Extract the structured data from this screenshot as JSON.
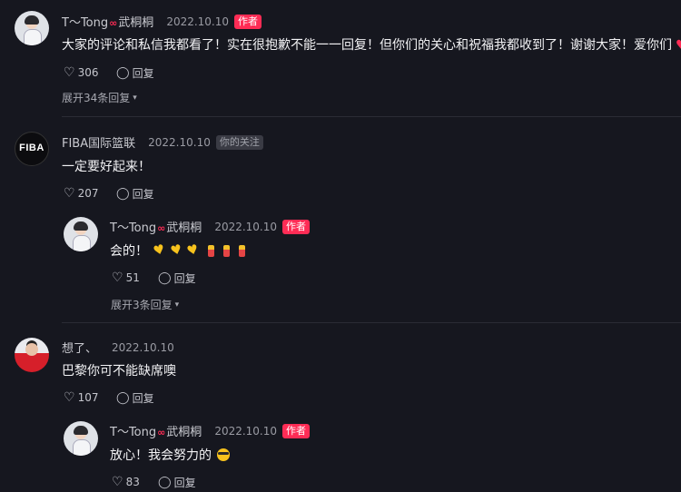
{
  "comments": [
    {
      "user": "T～Tong",
      "user_suffix": "武桐桐",
      "date": "2022.10.10",
      "badge": "作者",
      "text": "大家的评论和私信我都看了！实在很抱歉不能一一回复！但你们的关心和祝福我都收到了！谢谢大家！爱你们",
      "likes": "306",
      "reply_label": "回复",
      "expand_label": "展开34条回复"
    },
    {
      "user": "FIBA国际篮联",
      "avatar_text": "FIBA",
      "date": "2022.10.10",
      "badge": "你的关注",
      "text": "一定要好起来！",
      "likes": "207",
      "reply_label": "回复",
      "reply": {
        "user": "T～Tong",
        "user_suffix": "武桐桐",
        "date": "2022.10.10",
        "badge": "作者",
        "text": "会的！",
        "likes": "51",
        "reply_label": "回复",
        "expand_label": "展开3条回复"
      }
    },
    {
      "user": "想了、",
      "date": "2022.10.10",
      "text": "巴黎你可不能缺席噢",
      "likes": "107",
      "reply_label": "回复",
      "reply": {
        "user": "T～Tong",
        "user_suffix": "武桐桐",
        "date": "2022.10.10",
        "badge": "作者",
        "text": "放心！我会努力的",
        "likes": "83",
        "reply_label": "回复"
      }
    }
  ],
  "icons": {
    "like": "heart-outline-icon",
    "reply": "comment-bubble-icon",
    "expand": "chevron-down-icon",
    "accent": "#fe2c55"
  }
}
